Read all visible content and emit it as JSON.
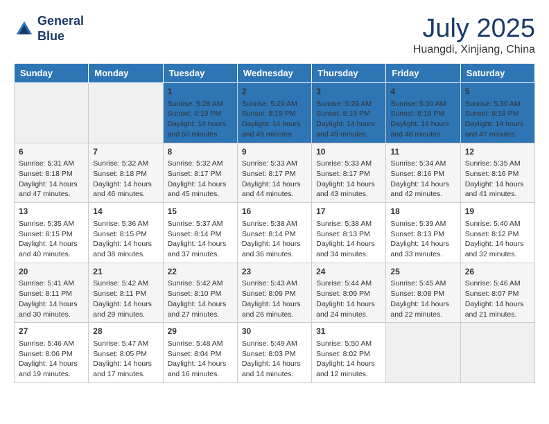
{
  "logo": {
    "line1": "General",
    "line2": "Blue"
  },
  "title": "July 2025",
  "location": "Huangdi, Xinjiang, China",
  "days_of_week": [
    "Sunday",
    "Monday",
    "Tuesday",
    "Wednesday",
    "Thursday",
    "Friday",
    "Saturday"
  ],
  "weeks": [
    [
      {
        "day": "",
        "sunrise": "",
        "sunset": "",
        "daylight": ""
      },
      {
        "day": "",
        "sunrise": "",
        "sunset": "",
        "daylight": ""
      },
      {
        "day": "1",
        "sunrise": "Sunrise: 5:28 AM",
        "sunset": "Sunset: 8:19 PM",
        "daylight": "Daylight: 14 hours and 50 minutes."
      },
      {
        "day": "2",
        "sunrise": "Sunrise: 5:29 AM",
        "sunset": "Sunset: 8:19 PM",
        "daylight": "Daylight: 14 hours and 49 minutes."
      },
      {
        "day": "3",
        "sunrise": "Sunrise: 5:29 AM",
        "sunset": "Sunset: 8:19 PM",
        "daylight": "Daylight: 14 hours and 49 minutes."
      },
      {
        "day": "4",
        "sunrise": "Sunrise: 5:30 AM",
        "sunset": "Sunset: 8:18 PM",
        "daylight": "Daylight: 14 hours and 48 minutes."
      },
      {
        "day": "5",
        "sunrise": "Sunrise: 5:30 AM",
        "sunset": "Sunset: 8:18 PM",
        "daylight": "Daylight: 14 hours and 47 minutes."
      }
    ],
    [
      {
        "day": "6",
        "sunrise": "Sunrise: 5:31 AM",
        "sunset": "Sunset: 8:18 PM",
        "daylight": "Daylight: 14 hours and 47 minutes."
      },
      {
        "day": "7",
        "sunrise": "Sunrise: 5:32 AM",
        "sunset": "Sunset: 8:18 PM",
        "daylight": "Daylight: 14 hours and 46 minutes."
      },
      {
        "day": "8",
        "sunrise": "Sunrise: 5:32 AM",
        "sunset": "Sunset: 8:17 PM",
        "daylight": "Daylight: 14 hours and 45 minutes."
      },
      {
        "day": "9",
        "sunrise": "Sunrise: 5:33 AM",
        "sunset": "Sunset: 8:17 PM",
        "daylight": "Daylight: 14 hours and 44 minutes."
      },
      {
        "day": "10",
        "sunrise": "Sunrise: 5:33 AM",
        "sunset": "Sunset: 8:17 PM",
        "daylight": "Daylight: 14 hours and 43 minutes."
      },
      {
        "day": "11",
        "sunrise": "Sunrise: 5:34 AM",
        "sunset": "Sunset: 8:16 PM",
        "daylight": "Daylight: 14 hours and 42 minutes."
      },
      {
        "day": "12",
        "sunrise": "Sunrise: 5:35 AM",
        "sunset": "Sunset: 8:16 PM",
        "daylight": "Daylight: 14 hours and 41 minutes."
      }
    ],
    [
      {
        "day": "13",
        "sunrise": "Sunrise: 5:35 AM",
        "sunset": "Sunset: 8:15 PM",
        "daylight": "Daylight: 14 hours and 40 minutes."
      },
      {
        "day": "14",
        "sunrise": "Sunrise: 5:36 AM",
        "sunset": "Sunset: 8:15 PM",
        "daylight": "Daylight: 14 hours and 38 minutes."
      },
      {
        "day": "15",
        "sunrise": "Sunrise: 5:37 AM",
        "sunset": "Sunset: 8:14 PM",
        "daylight": "Daylight: 14 hours and 37 minutes."
      },
      {
        "day": "16",
        "sunrise": "Sunrise: 5:38 AM",
        "sunset": "Sunset: 8:14 PM",
        "daylight": "Daylight: 14 hours and 36 minutes."
      },
      {
        "day": "17",
        "sunrise": "Sunrise: 5:38 AM",
        "sunset": "Sunset: 8:13 PM",
        "daylight": "Daylight: 14 hours and 34 minutes."
      },
      {
        "day": "18",
        "sunrise": "Sunrise: 5:39 AM",
        "sunset": "Sunset: 8:13 PM",
        "daylight": "Daylight: 14 hours and 33 minutes."
      },
      {
        "day": "19",
        "sunrise": "Sunrise: 5:40 AM",
        "sunset": "Sunset: 8:12 PM",
        "daylight": "Daylight: 14 hours and 32 minutes."
      }
    ],
    [
      {
        "day": "20",
        "sunrise": "Sunrise: 5:41 AM",
        "sunset": "Sunset: 8:11 PM",
        "daylight": "Daylight: 14 hours and 30 minutes."
      },
      {
        "day": "21",
        "sunrise": "Sunrise: 5:42 AM",
        "sunset": "Sunset: 8:11 PM",
        "daylight": "Daylight: 14 hours and 29 minutes."
      },
      {
        "day": "22",
        "sunrise": "Sunrise: 5:42 AM",
        "sunset": "Sunset: 8:10 PM",
        "daylight": "Daylight: 14 hours and 27 minutes."
      },
      {
        "day": "23",
        "sunrise": "Sunrise: 5:43 AM",
        "sunset": "Sunset: 8:09 PM",
        "daylight": "Daylight: 14 hours and 26 minutes."
      },
      {
        "day": "24",
        "sunrise": "Sunrise: 5:44 AM",
        "sunset": "Sunset: 8:09 PM",
        "daylight": "Daylight: 14 hours and 24 minutes."
      },
      {
        "day": "25",
        "sunrise": "Sunrise: 5:45 AM",
        "sunset": "Sunset: 8:08 PM",
        "daylight": "Daylight: 14 hours and 22 minutes."
      },
      {
        "day": "26",
        "sunrise": "Sunrise: 5:46 AM",
        "sunset": "Sunset: 8:07 PM",
        "daylight": "Daylight: 14 hours and 21 minutes."
      }
    ],
    [
      {
        "day": "27",
        "sunrise": "Sunrise: 5:46 AM",
        "sunset": "Sunset: 8:06 PM",
        "daylight": "Daylight: 14 hours and 19 minutes."
      },
      {
        "day": "28",
        "sunrise": "Sunrise: 5:47 AM",
        "sunset": "Sunset: 8:05 PM",
        "daylight": "Daylight: 14 hours and 17 minutes."
      },
      {
        "day": "29",
        "sunrise": "Sunrise: 5:48 AM",
        "sunset": "Sunset: 8:04 PM",
        "daylight": "Daylight: 14 hours and 16 minutes."
      },
      {
        "day": "30",
        "sunrise": "Sunrise: 5:49 AM",
        "sunset": "Sunset: 8:03 PM",
        "daylight": "Daylight: 14 hours and 14 minutes."
      },
      {
        "day": "31",
        "sunrise": "Sunrise: 5:50 AM",
        "sunset": "Sunset: 8:02 PM",
        "daylight": "Daylight: 14 hours and 12 minutes."
      },
      {
        "day": "",
        "sunrise": "",
        "sunset": "",
        "daylight": ""
      },
      {
        "day": "",
        "sunrise": "",
        "sunset": "",
        "daylight": ""
      }
    ]
  ]
}
